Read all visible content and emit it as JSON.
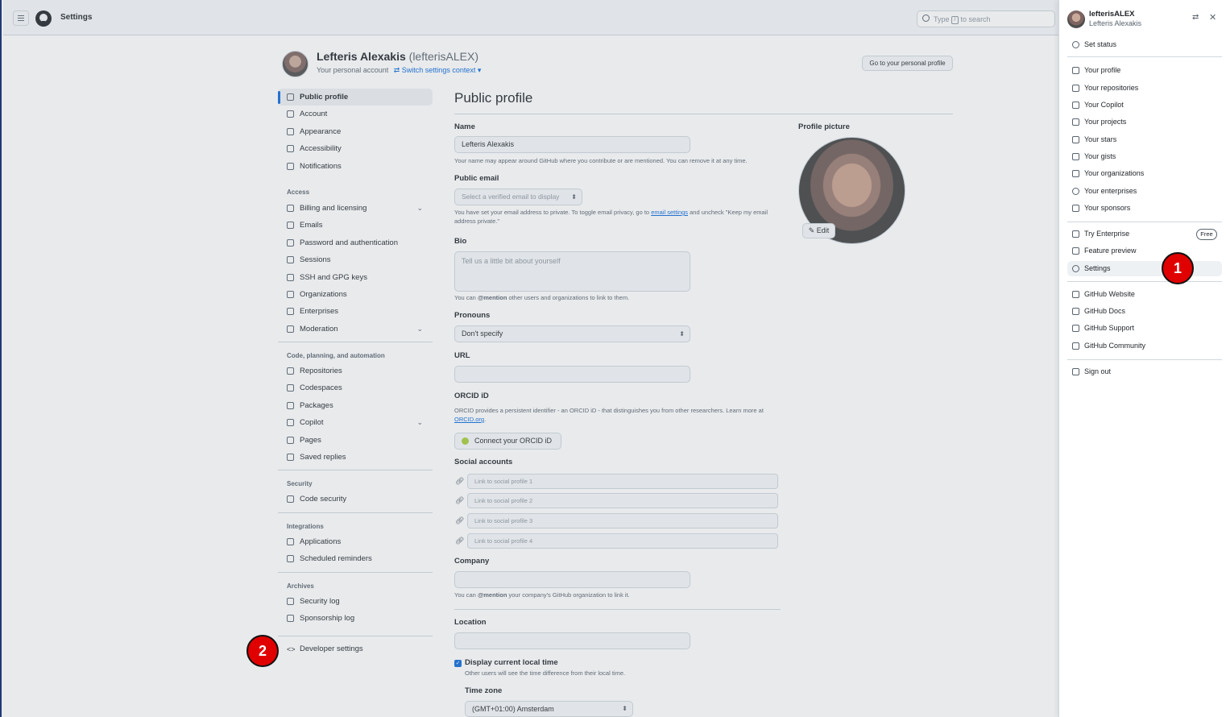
{
  "header": {
    "title": "Settings",
    "search_prefix": "Type",
    "search_key": "/",
    "search_suffix": "to search"
  },
  "profile_header": {
    "name": "Lefteris Alexakis",
    "login": "(lefterisALEX)",
    "context": "Your personal account",
    "switch": "Switch settings context",
    "personal_profile_button": "Go to your personal profile"
  },
  "nav": {
    "top": [
      "Public profile",
      "Account",
      "Appearance",
      "Accessibility",
      "Notifications"
    ],
    "access_header": "Access",
    "access": [
      "Billing and licensing",
      "Emails",
      "Password and authentication",
      "Sessions",
      "SSH and GPG keys",
      "Organizations",
      "Enterprises",
      "Moderation"
    ],
    "code_header": "Code, planning, and automation",
    "code": [
      "Repositories",
      "Codespaces",
      "Packages",
      "Copilot",
      "Pages",
      "Saved replies"
    ],
    "security_header": "Security",
    "security": [
      "Code security"
    ],
    "integrations_header": "Integrations",
    "integrations": [
      "Applications",
      "Scheduled reminders"
    ],
    "archives_header": "Archives",
    "archives": [
      "Security log",
      "Sponsorship log"
    ],
    "developer": "Developer settings"
  },
  "form": {
    "title": "Public profile",
    "name_label": "Name",
    "name_value": "Lefteris Alexakis",
    "name_note": "Your name may appear around GitHub where you contribute or are mentioned. You can remove it at any time.",
    "email_label": "Public email",
    "email_value": "Select a verified email to display",
    "email_note_1": "You have set your email address to private. To toggle email privacy, go to",
    "email_note_link": "email settings",
    "email_note_2": "and uncheck \"Keep my email address private.\"",
    "bio_label": "Bio",
    "bio_placeholder": "Tell us a little bit about yourself",
    "bio_note_1": "You can",
    "bio_note_mention": "@mention",
    "bio_note_2": "other users and organizations to link to them.",
    "pronouns_label": "Pronouns",
    "pronouns_value": "Don't specify",
    "url_label": "URL",
    "orcid_label": "ORCID iD",
    "orcid_note_1": "ORCID provides a persistent identifier - an ORCID iD - that distinguishes you from other researchers. Learn more at",
    "orcid_note_link": "ORCID.org",
    "orcid_button": "Connect your ORCID iD",
    "social_label": "Social accounts",
    "social": [
      "Link to social profile 1",
      "Link to social profile 2",
      "Link to social profile 3",
      "Link to social profile 4"
    ],
    "company_label": "Company",
    "company_note_1": "You can",
    "company_note_mention": "@mention",
    "company_note_2": "your company's GitHub organization to link it.",
    "location_label": "Location",
    "localtime_label": "Display current local time",
    "localtime_note": "Other users will see the time difference from their local time.",
    "timezone_label": "Time zone",
    "timezone_value": "(GMT+01:00) Amsterdam",
    "picture_label": "Profile picture",
    "edit_button": "Edit"
  },
  "panel": {
    "login": "lefterisALEX",
    "name": "Lefteris Alexakis",
    "status": "Set status",
    "group1": [
      "Your profile",
      "Your repositories",
      "Your Copilot",
      "Your projects",
      "Your stars",
      "Your gists",
      "Your organizations",
      "Your enterprises",
      "Your sponsors"
    ],
    "try_enterprise": "Try Enterprise",
    "free_badge": "Free",
    "feature_preview": "Feature preview",
    "settings": "Settings",
    "group3": [
      "GitHub Website",
      "GitHub Docs",
      "GitHub Support",
      "GitHub Community"
    ],
    "sign_out": "Sign out"
  },
  "markers": {
    "one": "1",
    "two": "2"
  },
  "colors": {
    "accent": "#0969da",
    "marker": "#e00000"
  }
}
